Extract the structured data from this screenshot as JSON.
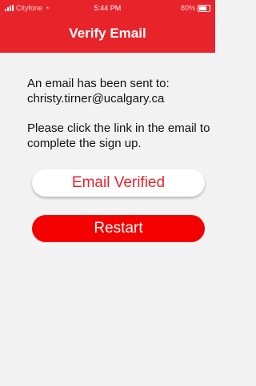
{
  "status_bar": {
    "carrier": "Cityfone",
    "time": "5:44 PM",
    "battery": "80%"
  },
  "header": {
    "title": "Verify Email"
  },
  "message": {
    "line1": "An email has been sent to: christy.tirner@ucalgary.ca",
    "line2": "Please click the link in the email to complete the sign up."
  },
  "buttons": {
    "email_verified": "Email Verified",
    "restart": "Restart"
  },
  "colors": {
    "accent": "#e8242b",
    "background": "#f2f2f2"
  }
}
